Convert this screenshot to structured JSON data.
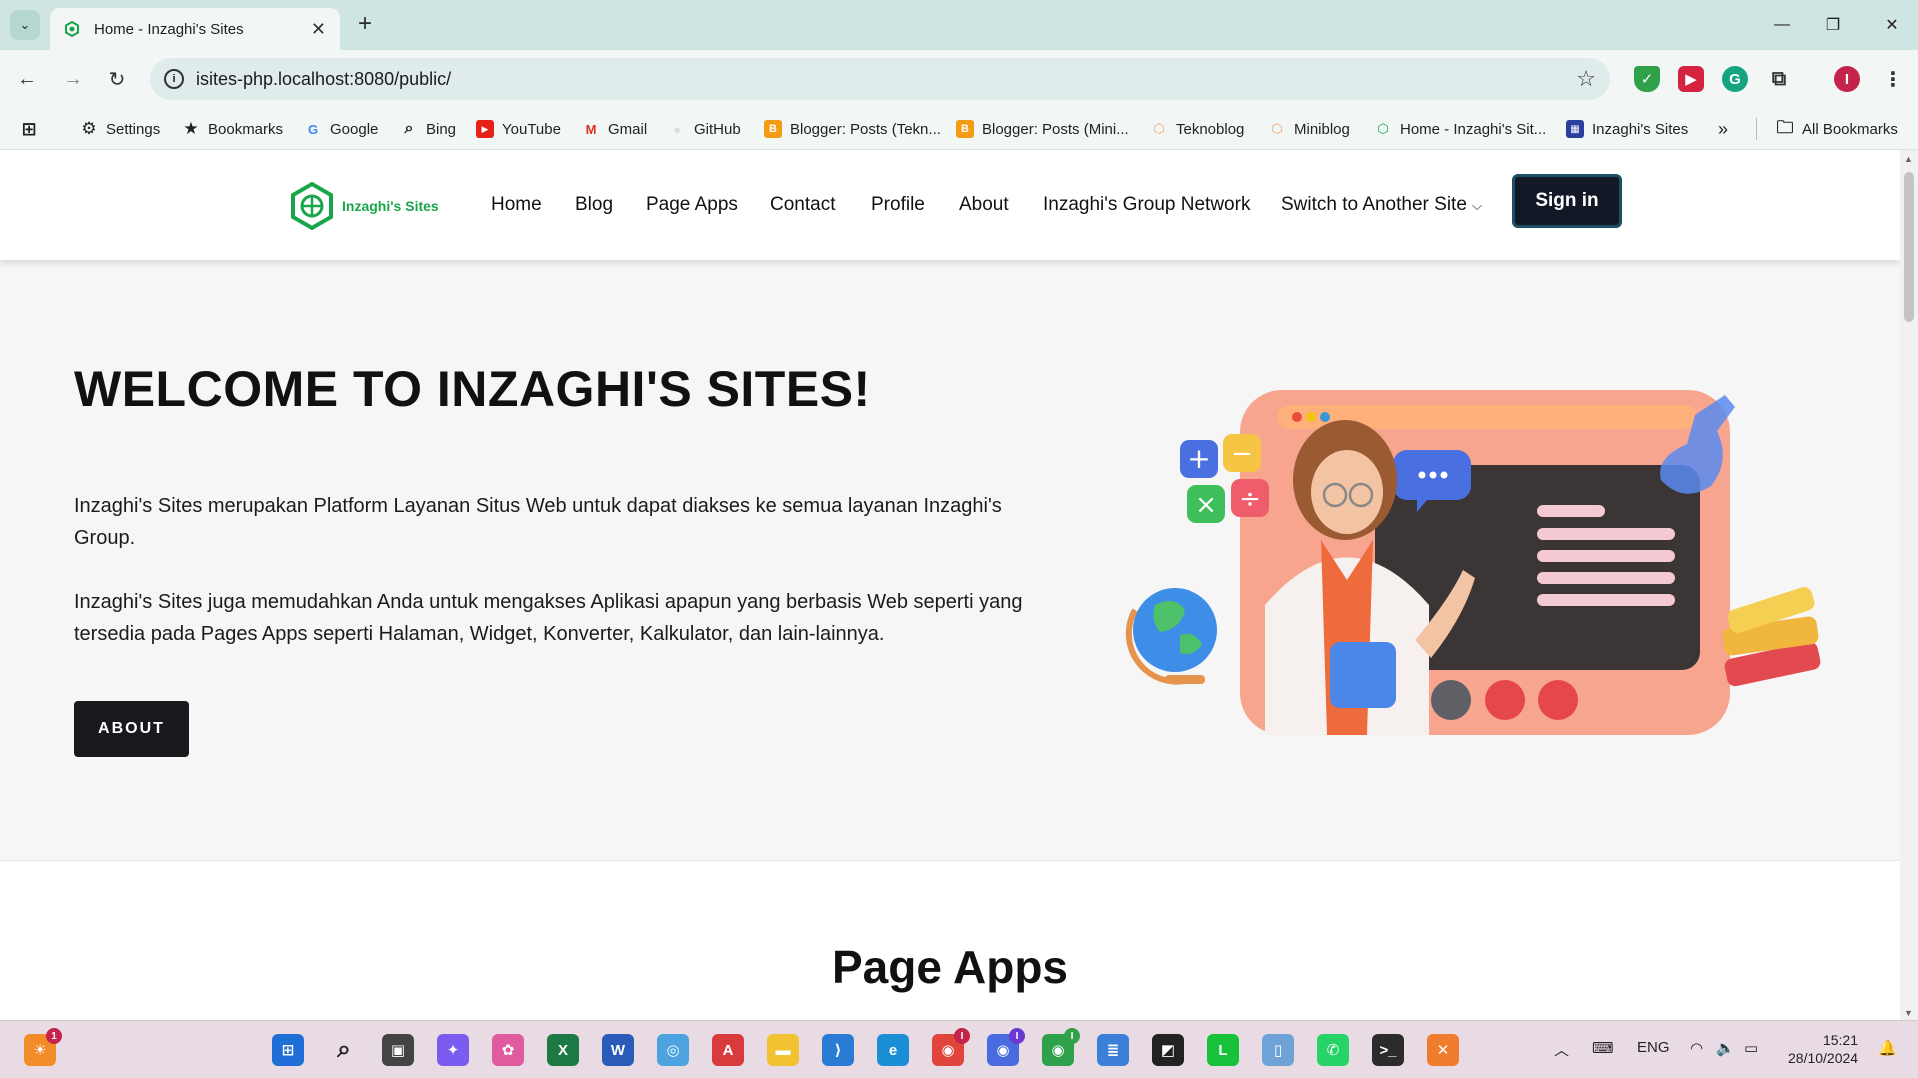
{
  "browser": {
    "tab_title": "Home - Inzaghi's Sites",
    "url": "isites-php.localhost:8080/public/",
    "profile_initial": "I"
  },
  "bookmarks": [
    {
      "label": "Settings",
      "icon": "gear-icon"
    },
    {
      "label": "Bookmarks",
      "icon": "star-icon"
    },
    {
      "label": "Google",
      "icon": "google-icon"
    },
    {
      "label": "Bing",
      "icon": "search-icon"
    },
    {
      "label": "YouTube",
      "icon": "youtube-icon"
    },
    {
      "label": "Gmail",
      "icon": "gmail-icon"
    },
    {
      "label": "GitHub",
      "icon": "github-icon"
    },
    {
      "label": "Blogger: Posts (Tekn...",
      "icon": "blogger-icon"
    },
    {
      "label": "Blogger: Posts (Mini...",
      "icon": "blogger-icon"
    },
    {
      "label": "Teknoblog",
      "icon": "hexagon-icon"
    },
    {
      "label": "Miniblog",
      "icon": "hexagon-icon"
    },
    {
      "label": "Home - Inzaghi's Sit...",
      "icon": "globe-icon"
    },
    {
      "label": "Inzaghi's Sites",
      "icon": "site-icon"
    }
  ],
  "all_bookmarks_label": "All Bookmarks",
  "site": {
    "logo_text": "Inzaghi's Sites",
    "nav": [
      "Home",
      "Blog",
      "Page Apps",
      "Contact",
      "Profile",
      "About",
      "Inzaghi's Group Network",
      "Switch to Another Site"
    ],
    "signin_label": "Sign in",
    "hero_title": "WELCOME TO INZAGHI'S SITES!",
    "hero_p1": "Inzaghi's Sites merupakan Platform Layanan Situs Web untuk dapat diakses ke semua layanan Inzaghi's Group.",
    "hero_p2": "Inzaghi's Sites juga memudahkan Anda untuk mengakses Aplikasi apapun yang berbasis Web seperti yang tersedia pada Pages Apps seperti Halaman, Widget, Konverter, Kalkulator, dan lain-lainnya.",
    "about_label": "ABOUT",
    "section_title": "Page Apps"
  },
  "taskbar": {
    "lang": "ENG",
    "time": "15:21",
    "date": "28/10/2024",
    "badges": {
      "weather": "1",
      "chrome1": "I",
      "chrome2": "I",
      "chrome3": "I"
    }
  },
  "colors": {
    "brand_green": "#19a64b",
    "signin_bg": "#121826",
    "titlebar": "#cfe5e1"
  }
}
